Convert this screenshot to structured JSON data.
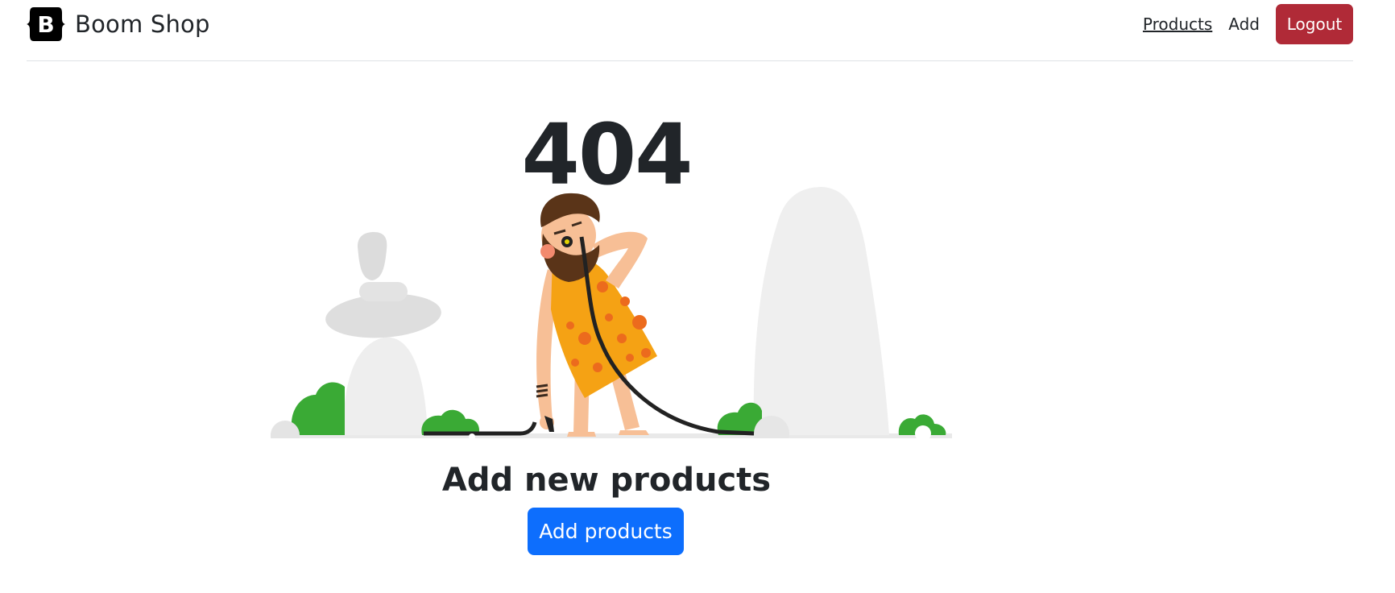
{
  "header": {
    "brand_name": "Boom Shop",
    "brand_logo_letter": "B",
    "nav": [
      {
        "label": "Products",
        "active": true
      },
      {
        "label": "Add",
        "active": false
      }
    ],
    "logout_label": "Logout"
  },
  "main": {
    "error_code": "404",
    "subtitle": "Add new products",
    "add_button_label": "Add products"
  },
  "colors": {
    "logout": "#b02a37",
    "primary": "#0d6efd",
    "text": "#212529"
  },
  "icons": {
    "brand": "bootstrap-logo-icon",
    "illustration": "caveman-404-illustration"
  }
}
